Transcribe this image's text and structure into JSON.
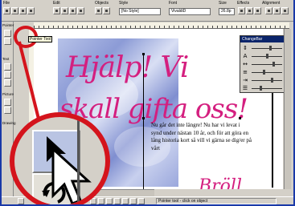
{
  "toolbar": {
    "labels": {
      "file": "File",
      "edit": "Edit",
      "objects": "Objects",
      "style": "Style",
      "font": "Font",
      "size": "Size",
      "effects": "Effects",
      "alignment": "Alignment"
    },
    "style_value": "[No Style]",
    "font_value": "VivaldiD",
    "size_value": "26.8p"
  },
  "palette": {
    "pointer_label": "Pointer",
    "text_label": "Text",
    "picture_label": "Picture",
    "drawing_label": "Drawing"
  },
  "tooltip": "Pointer Tool",
  "document": {
    "headline_line1": "Hjälp! Vi",
    "headline_line2": "skall gifta oss!",
    "body_text": "Nu går det inte längre! Nu har vi levat i synd under nästan 10 år, och för att göra en lång historia kort så vill vi gärna se dig/er på vårt",
    "bottom_text": "Bröll"
  },
  "change_palette": {
    "title": "ChangeBar",
    "rows": [
      {
        "icon": "↕-icon",
        "glyph": "⇕"
      },
      {
        "icon": "letter-a-icon",
        "glyph": "A"
      },
      {
        "icon": "spacing-icon",
        "glyph": "↔"
      },
      {
        "icon": "baseline-icon",
        "glyph": "≡"
      },
      {
        "icon": "indent-icon",
        "glyph": "⇥"
      },
      {
        "icon": "line-spacing-icon",
        "glyph": "☰"
      }
    ]
  },
  "status": {
    "message": "Pointer tool - click on object"
  }
}
